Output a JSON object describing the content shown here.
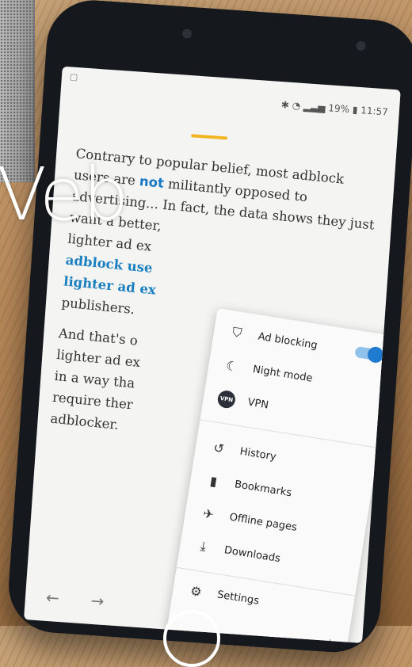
{
  "overlay_text": "Veb",
  "status_bar": {
    "battery": "19%",
    "time": "11:57"
  },
  "article": {
    "p1_before_strong": "Contrary to popular belief, most adblock users are ",
    "p1_strong": "not",
    "p1_after": " militantly opposed to advertising... In fact, the data shows they just want a better,",
    "p1_line2": "lighter ad ex",
    "p1_link1": "adblock use",
    "p1_link2": "lighter ad ex",
    "p1_end": "publishers.",
    "p2_line1": "And that's o",
    "p2_line2": "lighter ad ex",
    "p2_line3": "in a way tha",
    "p2_line4": "require ther",
    "p2_line5": "adblocker."
  },
  "menu": {
    "items_top": [
      {
        "label": "Ad blocking",
        "icon": "shield-icon"
      },
      {
        "label": "Night mode",
        "icon": "moon-icon"
      },
      {
        "label": "VPN",
        "icon": "vpn-icon"
      }
    ],
    "items_bottom": [
      {
        "label": "History",
        "icon": "history-icon"
      },
      {
        "label": "Bookmarks",
        "icon": "bookmark-icon"
      },
      {
        "label": "Offline pages",
        "icon": "airplane-icon"
      },
      {
        "label": "Downloads",
        "icon": "download-icon"
      },
      {
        "label": "Settings",
        "icon": "gear-icon"
      }
    ],
    "ad_blocking_enabled": true,
    "vpn_badge": "VPN"
  },
  "colors": {
    "accent": "#f2b620",
    "link": "#1a7fc0",
    "toggle": "#1f7ad0"
  }
}
